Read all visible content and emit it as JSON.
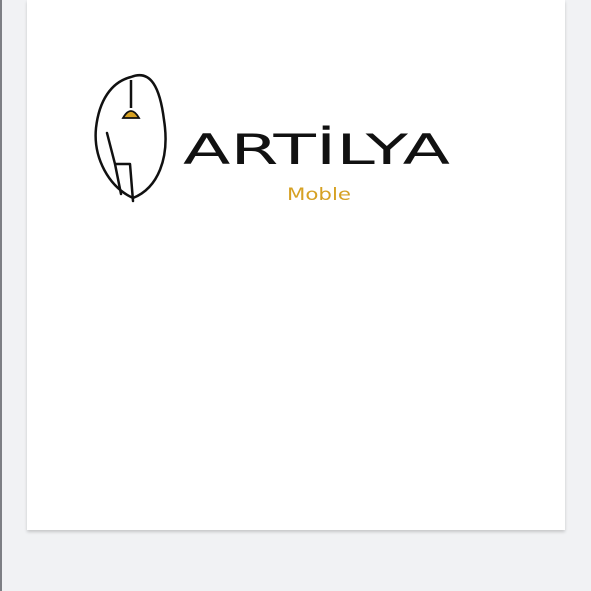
{
  "logo": {
    "name": "ARTİLYA",
    "subtitle": "Moble",
    "colors": {
      "ink": "#111111",
      "accent": "#d6a123",
      "card": "#ffffff",
      "background": "#f1f2f4"
    },
    "icon": "lamp-chair-circle-icon"
  }
}
